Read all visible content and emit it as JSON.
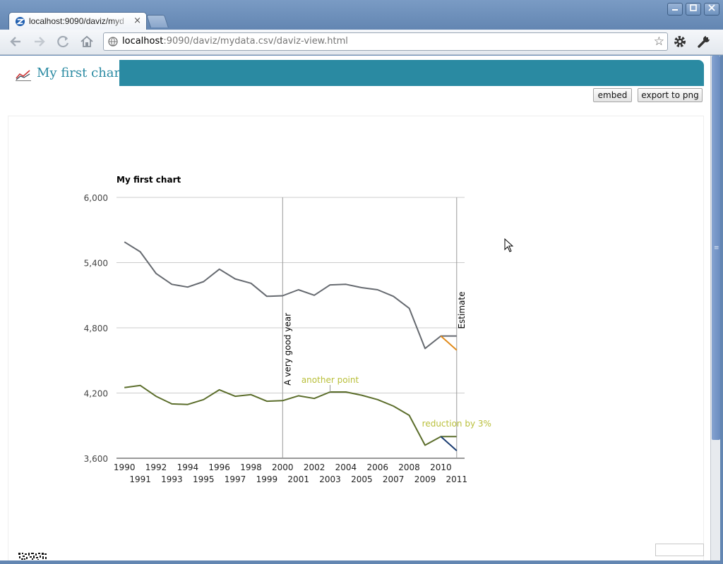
{
  "browser": {
    "tab_title": "localhost:9090/daviz/myd",
    "tab_close": "×",
    "url_host": "localhost",
    "url_rest": ":9090/daviz/mydata.csv/daviz-view.html"
  },
  "app": {
    "title": "My first chart",
    "embed_label": "embed",
    "export_label": "export to png"
  },
  "chart_data": {
    "type": "line",
    "title": "My first chart",
    "xlabel": "",
    "ylabel": "",
    "xlim": [
      1989.5,
      2011.5
    ],
    "ylim": [
      3600,
      6000
    ],
    "yticks": [
      3600,
      4200,
      4800,
      5400,
      6000
    ],
    "ytick_labels": [
      "3,600",
      "4,200",
      "4,800",
      "5,400",
      "6,000"
    ],
    "xticks_top": [
      "1990",
      "1992",
      "1994",
      "1996",
      "1998",
      "2000",
      "2002",
      "2004",
      "2006",
      "2008",
      "2010"
    ],
    "xticks_bottom": [
      "1991",
      "1993",
      "1995",
      "1997",
      "1999",
      "2001",
      "2003",
      "2005",
      "2007",
      "2009",
      "2011"
    ],
    "grid": true,
    "legend": "none",
    "x": [
      1990,
      1991,
      1992,
      1993,
      1994,
      1995,
      1996,
      1997,
      1998,
      1999,
      2000,
      2001,
      2002,
      2003,
      2004,
      2005,
      2006,
      2007,
      2008,
      2009,
      2010,
      2011
    ],
    "series": [
      {
        "color": "#666a70",
        "values": [
          5590,
          5500,
          5300,
          5200,
          5175,
          5225,
          5340,
          5250,
          5210,
          5090,
          5095,
          5150,
          5100,
          5195,
          5200,
          5170,
          5150,
          5090,
          4980,
          4610,
          4725,
          4725
        ]
      },
      {
        "color": "#e08a1a",
        "x": [
          2010,
          2011
        ],
        "values": [
          4725,
          4595
        ]
      },
      {
        "color": "#5c6e2c",
        "values": [
          4250,
          4270,
          4170,
          4100,
          4095,
          4140,
          4230,
          4170,
          4185,
          4125,
          4130,
          4175,
          4150,
          4210,
          4210,
          4180,
          4140,
          4080,
          3995,
          3720,
          3800,
          3800
        ]
      },
      {
        "color": "#1a3c70",
        "x": [
          2010,
          2011
        ],
        "values": [
          3800,
          3670
        ]
      }
    ],
    "annotations": [
      {
        "kind": "vline",
        "x": 2000,
        "label": "A very good year"
      },
      {
        "kind": "vline",
        "x": 2011,
        "label": "Estimate"
      },
      {
        "kind": "point",
        "x": 2003,
        "y": 4210,
        "label": "another point",
        "color": "#b9bf3a"
      },
      {
        "kind": "point",
        "x": 2011,
        "y": 3800,
        "label": "reduction by 3%",
        "color": "#b9bf3a"
      }
    ]
  }
}
